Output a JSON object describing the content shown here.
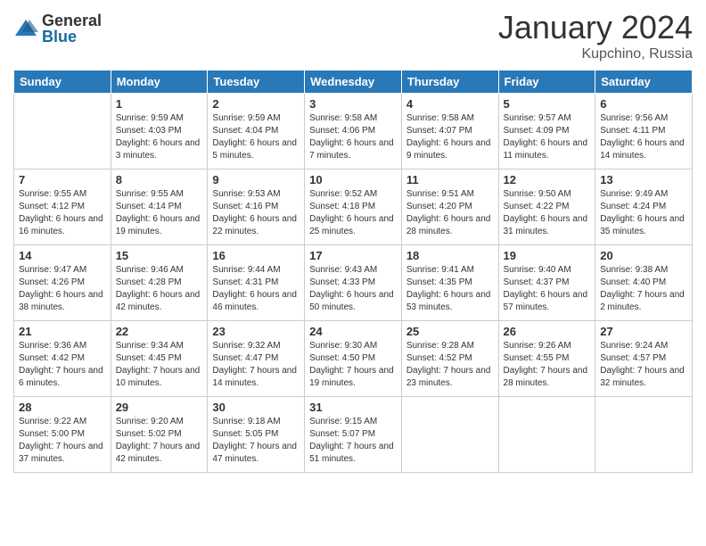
{
  "header": {
    "logo": {
      "general": "General",
      "blue": "Blue"
    },
    "title": "January 2024",
    "location": "Kupchino, Russia"
  },
  "columns": [
    "Sunday",
    "Monday",
    "Tuesday",
    "Wednesday",
    "Thursday",
    "Friday",
    "Saturday"
  ],
  "weeks": [
    [
      {
        "day": "",
        "sunrise": "",
        "sunset": "",
        "daylight": ""
      },
      {
        "day": "1",
        "sunrise": "Sunrise: 9:59 AM",
        "sunset": "Sunset: 4:03 PM",
        "daylight": "Daylight: 6 hours and 3 minutes."
      },
      {
        "day": "2",
        "sunrise": "Sunrise: 9:59 AM",
        "sunset": "Sunset: 4:04 PM",
        "daylight": "Daylight: 6 hours and 5 minutes."
      },
      {
        "day": "3",
        "sunrise": "Sunrise: 9:58 AM",
        "sunset": "Sunset: 4:06 PM",
        "daylight": "Daylight: 6 hours and 7 minutes."
      },
      {
        "day": "4",
        "sunrise": "Sunrise: 9:58 AM",
        "sunset": "Sunset: 4:07 PM",
        "daylight": "Daylight: 6 hours and 9 minutes."
      },
      {
        "day": "5",
        "sunrise": "Sunrise: 9:57 AM",
        "sunset": "Sunset: 4:09 PM",
        "daylight": "Daylight: 6 hours and 11 minutes."
      },
      {
        "day": "6",
        "sunrise": "Sunrise: 9:56 AM",
        "sunset": "Sunset: 4:11 PM",
        "daylight": "Daylight: 6 hours and 14 minutes."
      }
    ],
    [
      {
        "day": "7",
        "sunrise": "Sunrise: 9:55 AM",
        "sunset": "Sunset: 4:12 PM",
        "daylight": "Daylight: 6 hours and 16 minutes."
      },
      {
        "day": "8",
        "sunrise": "Sunrise: 9:55 AM",
        "sunset": "Sunset: 4:14 PM",
        "daylight": "Daylight: 6 hours and 19 minutes."
      },
      {
        "day": "9",
        "sunrise": "Sunrise: 9:53 AM",
        "sunset": "Sunset: 4:16 PM",
        "daylight": "Daylight: 6 hours and 22 minutes."
      },
      {
        "day": "10",
        "sunrise": "Sunrise: 9:52 AM",
        "sunset": "Sunset: 4:18 PM",
        "daylight": "Daylight: 6 hours and 25 minutes."
      },
      {
        "day": "11",
        "sunrise": "Sunrise: 9:51 AM",
        "sunset": "Sunset: 4:20 PM",
        "daylight": "Daylight: 6 hours and 28 minutes."
      },
      {
        "day": "12",
        "sunrise": "Sunrise: 9:50 AM",
        "sunset": "Sunset: 4:22 PM",
        "daylight": "Daylight: 6 hours and 31 minutes."
      },
      {
        "day": "13",
        "sunrise": "Sunrise: 9:49 AM",
        "sunset": "Sunset: 4:24 PM",
        "daylight": "Daylight: 6 hours and 35 minutes."
      }
    ],
    [
      {
        "day": "14",
        "sunrise": "Sunrise: 9:47 AM",
        "sunset": "Sunset: 4:26 PM",
        "daylight": "Daylight: 6 hours and 38 minutes."
      },
      {
        "day": "15",
        "sunrise": "Sunrise: 9:46 AM",
        "sunset": "Sunset: 4:28 PM",
        "daylight": "Daylight: 6 hours and 42 minutes."
      },
      {
        "day": "16",
        "sunrise": "Sunrise: 9:44 AM",
        "sunset": "Sunset: 4:31 PM",
        "daylight": "Daylight: 6 hours and 46 minutes."
      },
      {
        "day": "17",
        "sunrise": "Sunrise: 9:43 AM",
        "sunset": "Sunset: 4:33 PM",
        "daylight": "Daylight: 6 hours and 50 minutes."
      },
      {
        "day": "18",
        "sunrise": "Sunrise: 9:41 AM",
        "sunset": "Sunset: 4:35 PM",
        "daylight": "Daylight: 6 hours and 53 minutes."
      },
      {
        "day": "19",
        "sunrise": "Sunrise: 9:40 AM",
        "sunset": "Sunset: 4:37 PM",
        "daylight": "Daylight: 6 hours and 57 minutes."
      },
      {
        "day": "20",
        "sunrise": "Sunrise: 9:38 AM",
        "sunset": "Sunset: 4:40 PM",
        "daylight": "Daylight: 7 hours and 2 minutes."
      }
    ],
    [
      {
        "day": "21",
        "sunrise": "Sunrise: 9:36 AM",
        "sunset": "Sunset: 4:42 PM",
        "daylight": "Daylight: 7 hours and 6 minutes."
      },
      {
        "day": "22",
        "sunrise": "Sunrise: 9:34 AM",
        "sunset": "Sunset: 4:45 PM",
        "daylight": "Daylight: 7 hours and 10 minutes."
      },
      {
        "day": "23",
        "sunrise": "Sunrise: 9:32 AM",
        "sunset": "Sunset: 4:47 PM",
        "daylight": "Daylight: 7 hours and 14 minutes."
      },
      {
        "day": "24",
        "sunrise": "Sunrise: 9:30 AM",
        "sunset": "Sunset: 4:50 PM",
        "daylight": "Daylight: 7 hours and 19 minutes."
      },
      {
        "day": "25",
        "sunrise": "Sunrise: 9:28 AM",
        "sunset": "Sunset: 4:52 PM",
        "daylight": "Daylight: 7 hours and 23 minutes."
      },
      {
        "day": "26",
        "sunrise": "Sunrise: 9:26 AM",
        "sunset": "Sunset: 4:55 PM",
        "daylight": "Daylight: 7 hours and 28 minutes."
      },
      {
        "day": "27",
        "sunrise": "Sunrise: 9:24 AM",
        "sunset": "Sunset: 4:57 PM",
        "daylight": "Daylight: 7 hours and 32 minutes."
      }
    ],
    [
      {
        "day": "28",
        "sunrise": "Sunrise: 9:22 AM",
        "sunset": "Sunset: 5:00 PM",
        "daylight": "Daylight: 7 hours and 37 minutes."
      },
      {
        "day": "29",
        "sunrise": "Sunrise: 9:20 AM",
        "sunset": "Sunset: 5:02 PM",
        "daylight": "Daylight: 7 hours and 42 minutes."
      },
      {
        "day": "30",
        "sunrise": "Sunrise: 9:18 AM",
        "sunset": "Sunset: 5:05 PM",
        "daylight": "Daylight: 7 hours and 47 minutes."
      },
      {
        "day": "31",
        "sunrise": "Sunrise: 9:15 AM",
        "sunset": "Sunset: 5:07 PM",
        "daylight": "Daylight: 7 hours and 51 minutes."
      },
      {
        "day": "",
        "sunrise": "",
        "sunset": "",
        "daylight": ""
      },
      {
        "day": "",
        "sunrise": "",
        "sunset": "",
        "daylight": ""
      },
      {
        "day": "",
        "sunrise": "",
        "sunset": "",
        "daylight": ""
      }
    ]
  ]
}
